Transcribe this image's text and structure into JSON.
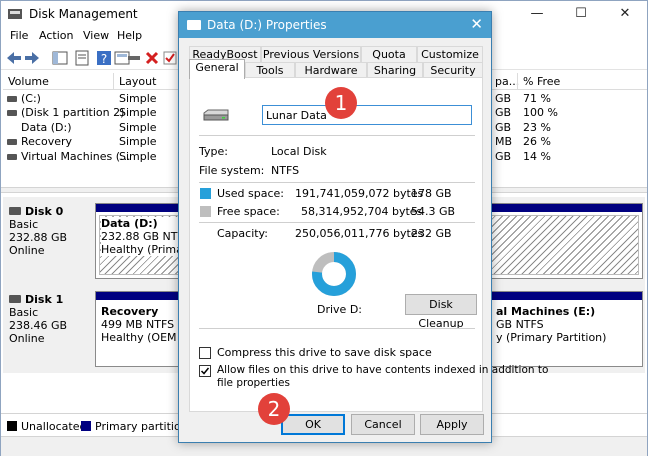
{
  "window": {
    "title": "Disk Management",
    "minimize": "—",
    "maximize": "☐",
    "close": "✕"
  },
  "menu": [
    "File",
    "Action",
    "View",
    "Help"
  ],
  "volume_list": {
    "columns": [
      "Volume",
      "Layout",
      "pa...",
      "% Free"
    ],
    "rows": [
      {
        "volume": "(C:)",
        "layout": "Simple",
        "cap": "GB",
        "free": "71 %"
      },
      {
        "volume": "(Disk 1 partition 2)",
        "layout": "Simple",
        "cap": "GB",
        "free": "100 %"
      },
      {
        "volume": "Data (D:)",
        "layout": "Simple",
        "cap": "GB",
        "free": "23 %"
      },
      {
        "volume": "Recovery",
        "layout": "Simple",
        "cap": "MB",
        "free": "26 %"
      },
      {
        "volume": "Virtual Machines (...",
        "layout": "Simple",
        "cap": "GB",
        "free": "14 %"
      }
    ]
  },
  "disks": [
    {
      "name": "Disk 0",
      "type": "Basic",
      "size": "232.88 GB",
      "status": "Online",
      "partitions": [
        {
          "name": "Data  (D:)",
          "line2": "232.88 GB NTFS",
          "line3": "Healthy (Primary"
        }
      ]
    },
    {
      "name": "Disk 1",
      "type": "Basic",
      "size": "238.46 GB",
      "status": "Online",
      "partitions": [
        {
          "name": "Recovery",
          "line2": "499 MB NTFS",
          "line3": "Healthy (OEM Par"
        },
        {
          "name": "al Machines  (E:)",
          "line2": "GB NTFS",
          "line3": "y (Primary Partition)"
        }
      ]
    }
  ],
  "legend": {
    "unallocated": "Unallocated",
    "primary": "Primary partition"
  },
  "dialog": {
    "title": "Data (D:) Properties",
    "close": "✕",
    "tabs_back": [
      "ReadyBoost",
      "Previous Versions",
      "Quota",
      "Customize"
    ],
    "tabs_front": [
      "General",
      "Tools",
      "Hardware",
      "Sharing",
      "Security"
    ],
    "name_value": "Lunar Data",
    "type_label": "Type:",
    "type_value": "Local Disk",
    "fs_label": "File system:",
    "fs_value": "NTFS",
    "used_label": "Used space:",
    "used_bytes": "191,741,059,072 bytes",
    "used_gb": "178 GB",
    "free_label": "Free space:",
    "free_bytes": "58,314,952,704 bytes",
    "free_gb": "54.3 GB",
    "cap_label": "Capacity:",
    "cap_bytes": "250,056,011,776 bytes",
    "cap_gb": "232 GB",
    "drive_label": "Drive D:",
    "cleanup": "Disk Cleanup",
    "compress": "Compress this drive to save disk space",
    "index_line1": "Allow files on this drive to have contents indexed in addition to",
    "index_line2": "file properties",
    "ok": "OK",
    "cancel": "Cancel",
    "apply": "Apply",
    "used_fraction": 0.767,
    "colors": {
      "used": "#26a0da",
      "free": "#bebebe"
    }
  },
  "badges": [
    "1",
    "2"
  ]
}
